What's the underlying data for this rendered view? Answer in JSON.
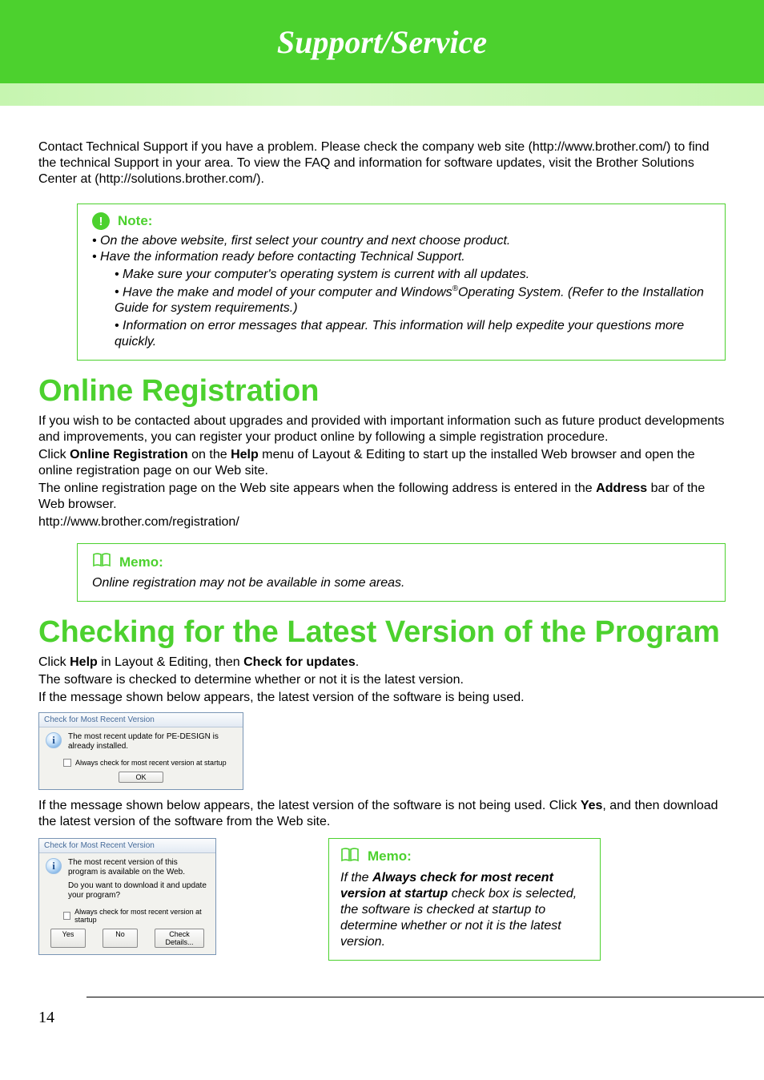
{
  "header": {
    "title": "Support/Service"
  },
  "intro": "Contact Technical Support if you have a problem. Please check the company web site (http://www.brother.com/) to find the technical Support in your area. To view the FAQ and information for software updates, visit the Brother Solutions Center at (http://solutions.brother.com/).",
  "note": {
    "label": "Note:",
    "b1": "On the above website, first select your country and next choose product.",
    "b2": "Have the information ready before contacting Technical Support.",
    "s1": "Make sure your computer's operating system is current with all updates.",
    "s2a": "Have the make and model of your computer and Windows",
    "s2sup": "®",
    "s2b": "Operating System. (Refer to the Installation Guide for system requirements.)",
    "s3": "Information on error messages that appear. This information will help expedite your questions more quickly."
  },
  "reg": {
    "heading": "Online Registration",
    "p1": "If you wish to be contacted about upgrades and provided with important information such as future product developments and improvements, you can register your product online by following a simple registration procedure.",
    "p2a": "Click ",
    "p2b": "Online Registration",
    "p2c": " on the ",
    "p2d": "Help",
    "p2e": " menu of Layout & Editing to start up the installed Web browser and open the online registration page on our Web site.",
    "p3a": "The online registration page on the Web site appears when the following address is entered in the ",
    "p3b": "Address",
    "p3c": " bar of the Web browser.",
    "url": "http://www.brother.com/registration/"
  },
  "memo1": {
    "label": "Memo:",
    "text": "Online registration may not be available in some areas."
  },
  "check": {
    "heading": "Checking for the Latest Version of the Program",
    "p1a": "Click ",
    "p1b": "Help",
    "p1c": " in Layout & Editing, then ",
    "p1d": "Check for updates",
    "p1e": ".",
    "p2": "The software is checked to determine whether or not it is the latest version.",
    "p3": "If the message shown below appears, the latest version of the software is being used.",
    "p4a": "If the message shown below appears, the latest version of the software is not being used. Click ",
    "p4b": "Yes",
    "p4c": ", and then download the latest version of the software from the Web site."
  },
  "dialog1": {
    "title": "Check for Most Recent Version",
    "msg": "The most recent update for PE-DESIGN is already installed.",
    "chk": "Always check for most recent version at startup",
    "ok": "OK"
  },
  "dialog2": {
    "title": "Check for Most Recent Version",
    "msg1": "The most recent version of this program is available on the Web.",
    "msg2": "Do you want to download it and update your program?",
    "chk": "Always check for most recent version at startup",
    "yes": "Yes",
    "no": "No",
    "details": "Check Details..."
  },
  "memo2": {
    "label": "Memo:",
    "t1": "If the ",
    "t2": "Always check for most recent version at startup",
    "t3": " check box is selected, the software is checked at startup to determine whether or not it is the latest version."
  },
  "footer": {
    "page": "14"
  }
}
